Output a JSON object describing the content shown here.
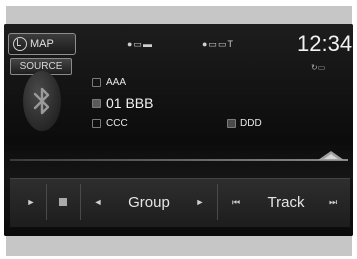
{
  "header": {
    "map_label": "MAP",
    "status_left": "●▭▬",
    "status_right": "●▭▭T",
    "clock": "12:34"
  },
  "source_label": "SOURCE",
  "repeat_indicator": "↻▭",
  "now_playing": {
    "line1": "AAA",
    "line2": "01 BBB",
    "line3": "CCC",
    "line4": "DDD"
  },
  "icons": {
    "bluetooth": "bluetooth-icon",
    "map": "map-icon"
  },
  "progress": {
    "position_fraction": 0.95
  },
  "controls": {
    "play_label": "►",
    "stop_label": "■",
    "group_prev": "◄",
    "group_label": "Group",
    "group_next": "►",
    "track_prev": "⏮",
    "track_label": "Track",
    "track_next": "⏭"
  },
  "colors": {
    "screen_bg": "#111111",
    "frame": "#c6c6c6",
    "text": "#e8e8e8"
  }
}
